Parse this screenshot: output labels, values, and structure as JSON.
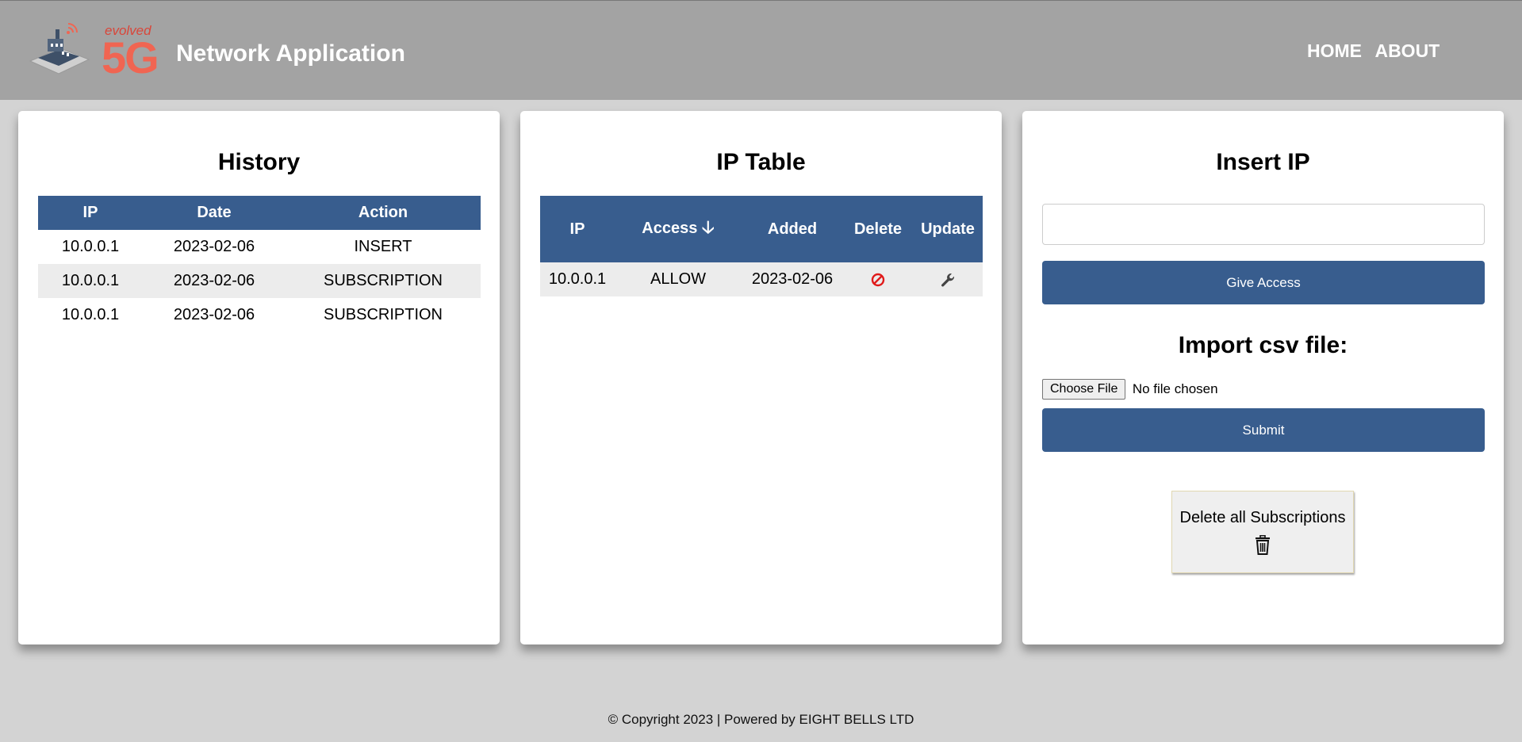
{
  "header": {
    "logo_text_small": "evolved",
    "logo_text_big": "5G",
    "title": "Network Application",
    "nav": [
      "HOME",
      "ABOUT"
    ]
  },
  "history": {
    "title": "History",
    "columns": [
      "IP",
      "Date",
      "Action"
    ],
    "rows": [
      {
        "ip": "10.0.0.1",
        "date": "2023-02-06",
        "action": "INSERT"
      },
      {
        "ip": "10.0.0.1",
        "date": "2023-02-06",
        "action": "SUBSCRIPTION"
      },
      {
        "ip": "10.0.0.1",
        "date": "2023-02-06",
        "action": "SUBSCRIPTION"
      }
    ]
  },
  "ip_table": {
    "title": "IP Table",
    "columns": [
      "IP",
      "Access",
      "Added",
      "Delete",
      "Update"
    ],
    "sort_icon": "arrow-down-icon",
    "rows": [
      {
        "ip": "10.0.0.1",
        "access": "ALLOW",
        "added": "2023-02-06",
        "delete_icon": "block-icon",
        "update_icon": "wrench-icon"
      }
    ]
  },
  "insert": {
    "title": "Insert IP",
    "input_value": "",
    "input_placeholder": "",
    "give_access_label": "Give Access",
    "import_title": "Import csv file:",
    "choose_file_label": "Choose File",
    "file_status": "No file chosen",
    "submit_label": "Submit",
    "delete_all_label": "Delete all Subscriptions",
    "delete_all_icon": "trash-icon"
  },
  "colors": {
    "header_bg": "#a3a3a3",
    "page_bg": "#d3d3d3",
    "primary": "#385d8e",
    "logo_red": "#f06552",
    "delete_red": "#e01a1a"
  },
  "footer": {
    "text": "© Copyright 2023 | Powered by EIGHT BELLS LTD"
  }
}
